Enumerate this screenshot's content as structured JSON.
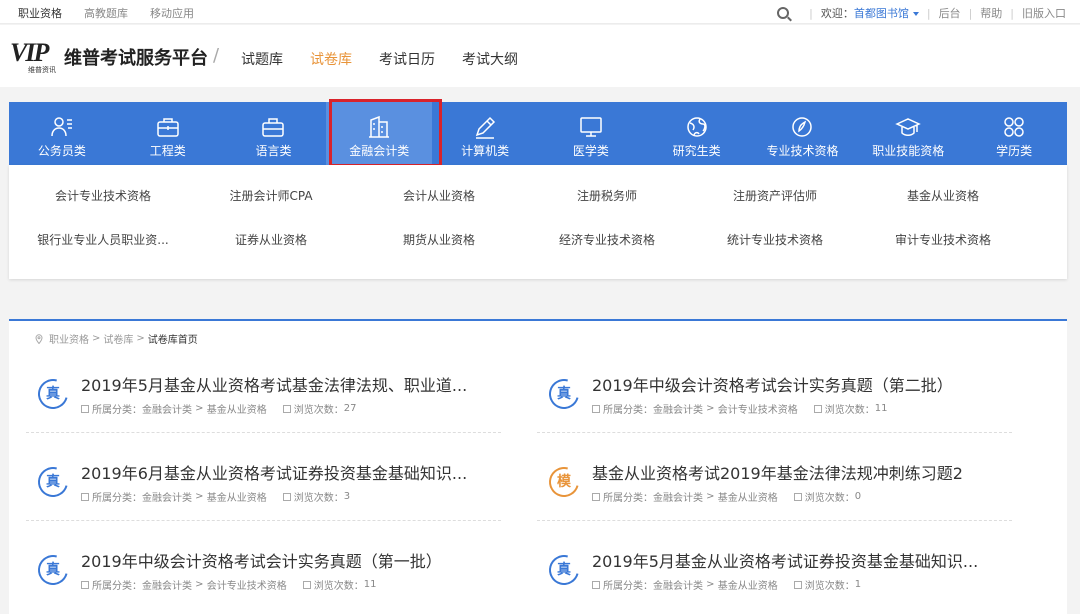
{
  "topbar": {
    "links": [
      "职业资格",
      "高教题库",
      "移动应用"
    ],
    "welcome_label": "欢迎：",
    "welcome_user": "首都图书馆",
    "right_links": [
      "后台",
      "帮助",
      "旧版入口"
    ]
  },
  "header": {
    "logo_text": "VIP",
    "logo_sub": "维普资讯",
    "brand": "维普考试服务平台",
    "nav": [
      "试题库",
      "试卷库",
      "考试日历",
      "考试大纲"
    ],
    "nav_active": "试卷库"
  },
  "categories": [
    {
      "label": "公务员类",
      "icon": "person-list-icon"
    },
    {
      "label": "工程类",
      "icon": "briefcase-icon"
    },
    {
      "label": "语言类",
      "icon": "briefcase-icon"
    },
    {
      "label": "金融会计类",
      "icon": "building-icon",
      "active": true
    },
    {
      "label": "计算机类",
      "icon": "pencil-icon"
    },
    {
      "label": "医学类",
      "icon": "monitor-icon"
    },
    {
      "label": "研究生类",
      "icon": "globe-icon"
    },
    {
      "label": "专业技术资格",
      "icon": "compass-icon"
    },
    {
      "label": "职业技能资格",
      "icon": "graduation-cap-icon"
    },
    {
      "label": "学历类",
      "icon": "grid-circles-icon"
    }
  ],
  "subcategories": {
    "row1": [
      "会计专业技术资格",
      "注册会计师CPA",
      "会计从业资格",
      "注册税务师",
      "注册资产评估师",
      "基金从业资格"
    ],
    "row2": [
      "银行业专业人员职业资...",
      "证券从业资格",
      "期货从业资格",
      "经济专业技术资格",
      "统计专业技术资格",
      "审计专业技术资格"
    ]
  },
  "breadcrumb": [
    "职业资格",
    "试卷库",
    "试卷库首页"
  ],
  "meta_labels": {
    "category": "所属分类：",
    "views": "浏览次数："
  },
  "papers": [
    {
      "badge": "真",
      "title": "2019年5月基金从业资格考试基金法律法规、职业道...",
      "cat1": "金融会计类",
      "cat2": "基金从业资格",
      "views": "27"
    },
    {
      "badge": "真",
      "title": "2019年中级会计资格考试会计实务真题（第二批）",
      "cat1": "金融会计类",
      "cat2": "会计专业技术资格",
      "views": "11"
    },
    {
      "badge": "真",
      "title": "2019年6月基金从业资格考试证券投资基金基础知识...",
      "cat1": "金融会计类",
      "cat2": "基金从业资格",
      "views": "3"
    },
    {
      "badge": "模",
      "title": "基金从业资格考试2019年基金法律法规冲刺练习题2",
      "cat1": "金融会计类",
      "cat2": "基金从业资格",
      "views": "0"
    },
    {
      "badge": "真",
      "title": "2019年中级会计资格考试会计实务真题（第一批）",
      "cat1": "金融会计类",
      "cat2": "会计专业技术资格",
      "views": "11"
    },
    {
      "badge": "真",
      "title": "2019年5月基金从业资格考试证券投资基金基础知识...",
      "cat1": "金融会计类",
      "cat2": "基金从业资格",
      "views": "1"
    }
  ],
  "colors": {
    "primary": "#3a78d6",
    "accent": "#e8943a",
    "highlight": "#d9232b"
  }
}
